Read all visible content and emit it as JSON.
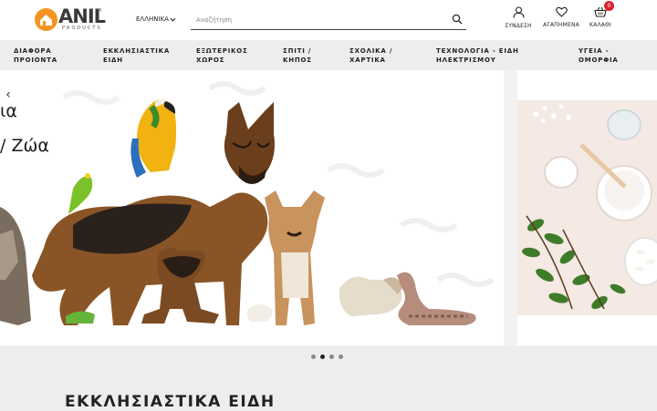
{
  "header": {
    "logo": {
      "text": "ANIL",
      "sub": "PRODUCTS",
      "reg": "®"
    },
    "language": {
      "label": "ΕΛΛΗΝΙΚΑ"
    },
    "search": {
      "placeholder": "Αναζήτηση"
    },
    "actions": {
      "login": "ΣΥΝΔΕΣΗ",
      "favorites": "ΑΓΑΠΗΜΕΝΑ",
      "cart": "ΚΑΛΑΘΙ",
      "cart_count": "0"
    }
  },
  "nav": {
    "items": [
      {
        "line1": "ΔΙΑΦΟΡΑ",
        "line2": "ΠΡΟΙΟΝΤΑ"
      },
      {
        "line1": "ΕΚΚΛΗΣΙΑΣΤΙΚΑ",
        "line2": "ΕΙΔΗ"
      },
      {
        "line1": "ΕΞΩΤΕΡΙΚΟΣ",
        "line2": "ΧΩΡΟΣ"
      },
      {
        "line1": "ΣΠΙΤΙ /",
        "line2": "ΚΗΠΟΣ"
      },
      {
        "line1": "ΣΧΟΛΙΚΑ /",
        "line2": "ΧΑΡΤΙΚΑ"
      },
      {
        "line1": "ΤΕΧΝΟΛΟΓΙΑ - ΕΙΔΗ",
        "line2": "ΗΛΕΚΤΡΙΣΜΟΥ"
      },
      {
        "line1": "ΥΓΕΙΑ -",
        "line2": "ΟΜΟΡΦΙΑ"
      }
    ]
  },
  "slider": {
    "slide_text_1": "ια",
    "slide_text_2": "/ Ζώα",
    "prev_icon": "chevron-left-icon",
    "dots": 4,
    "active_dot": 1
  },
  "section": {
    "title": "ΕΚΚΛΗΣΙΑΣΤΙΚΑ ΕΙΔΗ"
  },
  "colors": {
    "brand": "#f39422",
    "badge": "#d9232d",
    "nav_bg": "#ededed"
  }
}
